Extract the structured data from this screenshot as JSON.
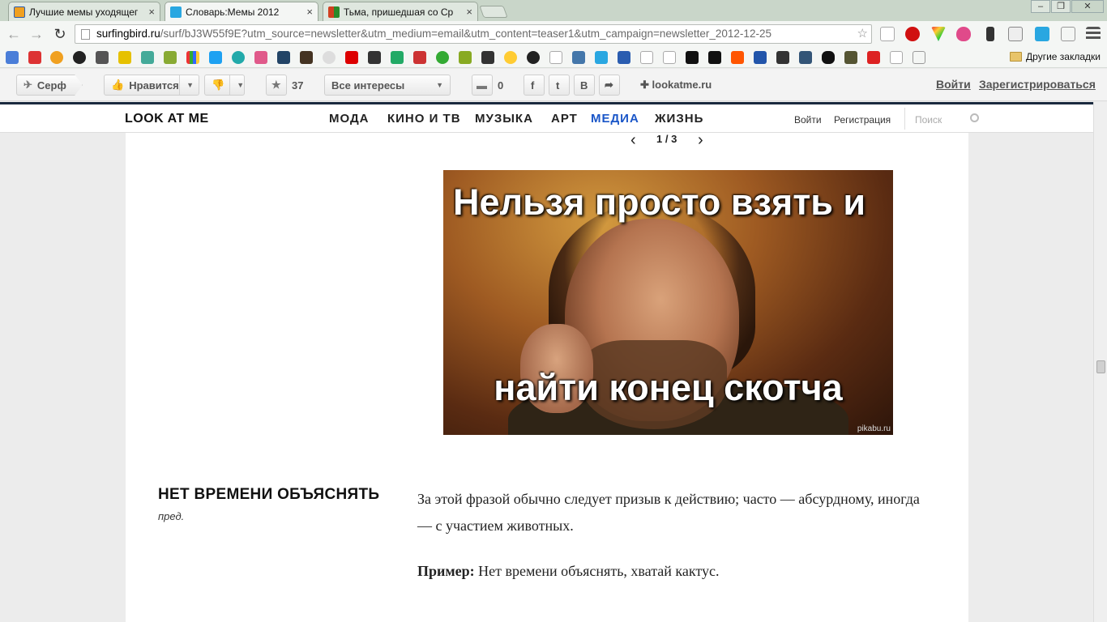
{
  "browser": {
    "tabs": [
      {
        "title": "Лучшие мемы уходящег",
        "active": false,
        "favicon_color": "#f0a020"
      },
      {
        "title": "Словарь:Мемы 2012",
        "active": true,
        "favicon_color": "#29a7e1"
      },
      {
        "title": "Тьма, пришедшая со Ср",
        "active": false,
        "favicon_color": "#d04020"
      }
    ],
    "close_glyph": "×",
    "window_controls": [
      "–",
      "❐",
      "✕"
    ],
    "url_host": "surfingbird.ru",
    "url_path": "/surf/bJ3W55f9E?utm_source=newsletter&utm_medium=email&utm_content=teaser1&utm_campaign=newsletter_2012-12-25",
    "other_bookmarks": "Другие закладки"
  },
  "surfingbird": {
    "surf_label": "Серф",
    "like_label": "Нравится",
    "favorites_count": "37",
    "interests_label": "Все интересы",
    "comments_count": "0",
    "social_f": "f",
    "social_t": "t",
    "social_b": "B",
    "source_link": "lookatme.ru",
    "login_label": "Войти",
    "register_label": "Зарегистрироваться"
  },
  "site": {
    "logo": "LOOK AT ME",
    "menu": [
      {
        "label": "МОДА",
        "active": false
      },
      {
        "label": "КИНО И ТВ",
        "active": false
      },
      {
        "label": "МУЗЫКА",
        "active": false
      },
      {
        "label": "АРТ",
        "active": false
      },
      {
        "label": "МЕДИА",
        "active": true
      },
      {
        "label": "ЖИЗНЬ",
        "active": false
      }
    ],
    "login": "Войти",
    "register": "Регистрация",
    "search_placeholder": "Поиск"
  },
  "article": {
    "pager": "1 / 3",
    "meme_top_text": "Нельзя просто взять и",
    "meme_bottom_text": "найти конец скотча",
    "meme_watermark": "pikabu.ru",
    "term": "НЕТ ВРЕМЕНИ ОБЪЯСНЯТЬ",
    "part_of_speech": "пред.",
    "definition": "За этой фразой обычно следует призыв к действию; часто — абсурдному, иногда — с участием животных.",
    "example_label": "Пример:",
    "example_text": "Нет времени объяснять, хватай кактус."
  },
  "colors": {
    "nav_active": "#1a56c8",
    "nav_border": "#1b2a3f"
  }
}
